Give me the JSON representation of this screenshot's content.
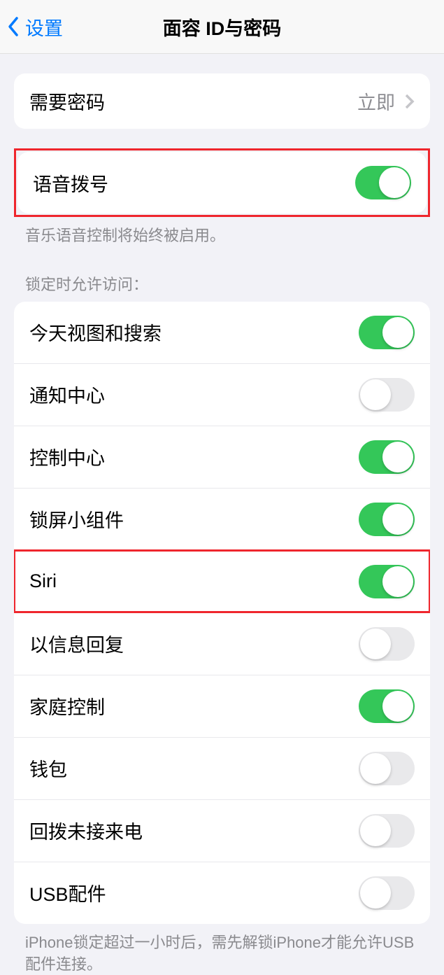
{
  "header": {
    "back_label": "设置",
    "title": "面容 ID与密码"
  },
  "require_passcode": {
    "label": "需要密码",
    "value": "立即"
  },
  "voice_dial": {
    "label": "语音拨号",
    "enabled": true,
    "footer": "音乐语音控制将始终被启用。"
  },
  "lock_access": {
    "header": "锁定时允许访问：",
    "items": [
      {
        "label": "今天视图和搜索",
        "enabled": true
      },
      {
        "label": "通知中心",
        "enabled": false
      },
      {
        "label": "控制中心",
        "enabled": true
      },
      {
        "label": "锁屏小组件",
        "enabled": true
      },
      {
        "label": "Siri",
        "enabled": true
      },
      {
        "label": "以信息回复",
        "enabled": false
      },
      {
        "label": "家庭控制",
        "enabled": true
      },
      {
        "label": "钱包",
        "enabled": false
      },
      {
        "label": "回拨未接来电",
        "enabled": false
      },
      {
        "label": "USB配件",
        "enabled": false
      }
    ],
    "footer": "iPhone锁定超过一小时后，需先解锁iPhone才能允许USB配件连接。"
  }
}
